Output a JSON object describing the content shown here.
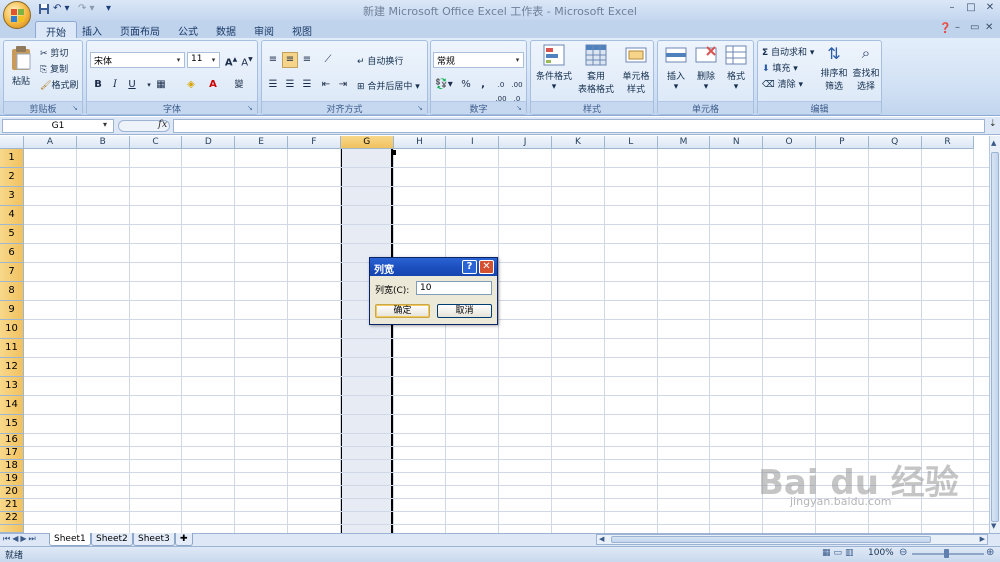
{
  "window": {
    "title": "新建 Microsoft Office Excel 工作表 - Microsoft Excel",
    "controls": [
      "–",
      "□",
      "✕"
    ]
  },
  "tabs": [
    {
      "label": "开始",
      "active": true
    },
    {
      "label": "插入"
    },
    {
      "label": "页面布局"
    },
    {
      "label": "公式"
    },
    {
      "label": "数据"
    },
    {
      "label": "审阅"
    },
    {
      "label": "视图"
    }
  ],
  "ribbon": {
    "clipboard": {
      "group": "剪贴板",
      "paste": "粘贴",
      "cut": "剪切",
      "copy": "复制",
      "format_painter": "格式刷"
    },
    "font": {
      "group": "字体",
      "font_name": "宋体",
      "font_size": "11",
      "bold": "B",
      "italic": "I",
      "underline": "U"
    },
    "alignment": {
      "group": "对齐方式",
      "wrap": "自动换行",
      "merge": "合并后居中"
    },
    "number": {
      "group": "数字",
      "format": "常规",
      "percent": "%",
      "comma": ","
    },
    "styles": {
      "group": "样式",
      "conditional": "条件格式",
      "table1": "套用",
      "table2": "表格格式",
      "cell1": "单元格",
      "cell2": "样式"
    },
    "cells": {
      "group": "单元格",
      "insert": "插入",
      "delete": "删除",
      "format": "格式"
    },
    "editing": {
      "group": "编辑",
      "autosum": "自动求和",
      "fill": "填充",
      "clear": "清除",
      "sort1": "排序和",
      "sort2": "筛选",
      "find1": "查找和",
      "find2": "选择"
    }
  },
  "formula_bar": {
    "name_box": "G1",
    "fx": "fx",
    "value": ""
  },
  "columns": [
    "A",
    "B",
    "C",
    "D",
    "E",
    "F",
    "G",
    "H",
    "I",
    "J",
    "K",
    "L",
    "M",
    "N",
    "O",
    "P",
    "Q",
    "R"
  ],
  "selected_column": "G",
  "rows": [
    "1",
    "2",
    "3",
    "4",
    "5",
    "6",
    "7",
    "8",
    "9",
    "10",
    "11",
    "12",
    "13",
    "14",
    "15",
    "16",
    "17",
    "18",
    "19",
    "20",
    "21",
    "22"
  ],
  "sheets": [
    {
      "label": "Sheet1",
      "active": true
    },
    {
      "label": "Sheet2"
    },
    {
      "label": "Sheet3"
    }
  ],
  "status": {
    "text": "就绪",
    "zoom": "100%"
  },
  "dialog": {
    "title": "列宽",
    "help": "?",
    "close": "✕",
    "label": "列宽(C):",
    "value": "10",
    "ok": "确定",
    "cancel": "取消"
  },
  "watermark": {
    "brand": "Bai du 经验",
    "url": "jingyan.baidu.com"
  }
}
